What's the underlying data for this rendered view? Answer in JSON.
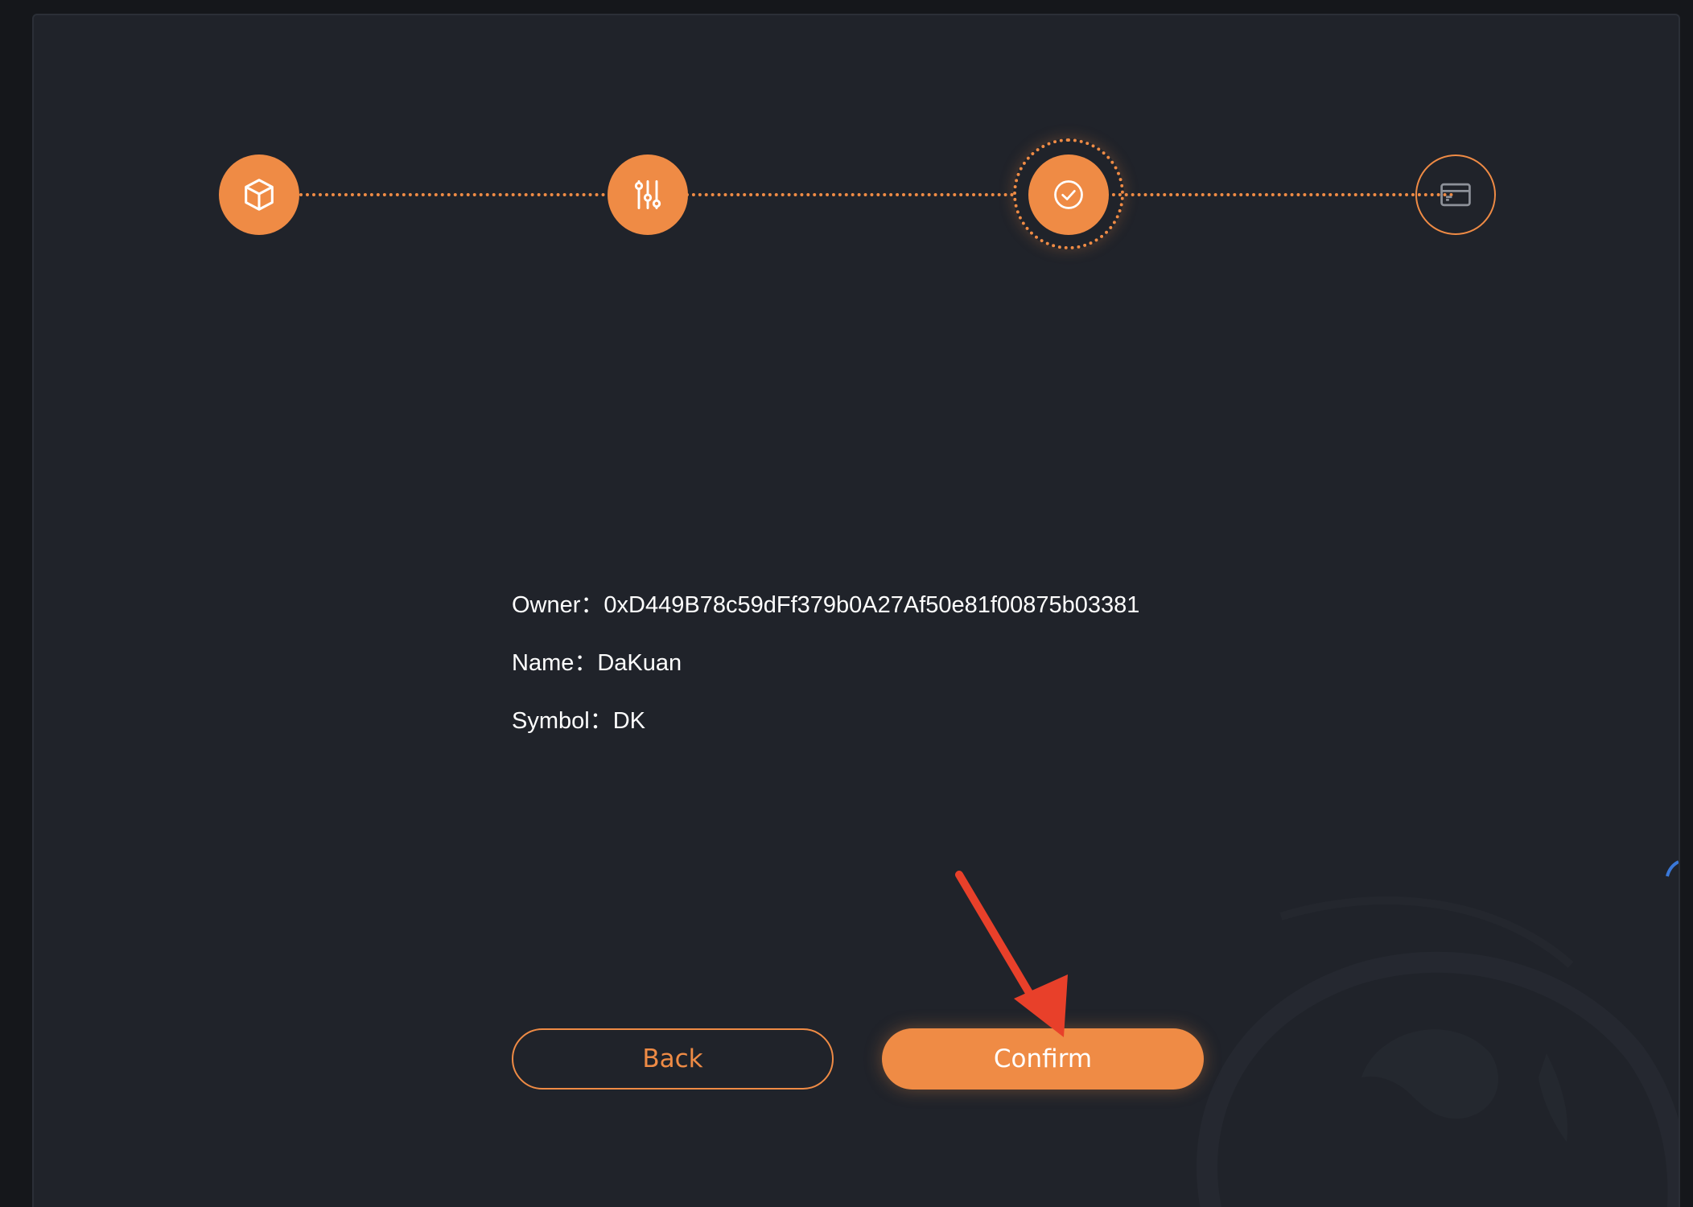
{
  "stepper": {
    "accent_color": "#ef8b45",
    "steps": [
      {
        "icon": "cube-icon",
        "state": "done"
      },
      {
        "icon": "sliders-icon",
        "state": "done"
      },
      {
        "icon": "check-circle-icon",
        "state": "active"
      },
      {
        "icon": "card-icon",
        "state": "pending"
      }
    ]
  },
  "summary": {
    "owner": "Owner：0xD449B78c59dFf379b0A27Af50e81f00875b03381",
    "name": "Name：DaKuan",
    "symbol": "Symbol：DK"
  },
  "actions": {
    "back_label": "Back",
    "confirm_label": "Confirm"
  },
  "annotation": {
    "arrow_color": "#e8402a",
    "points_to": "confirm-button"
  }
}
